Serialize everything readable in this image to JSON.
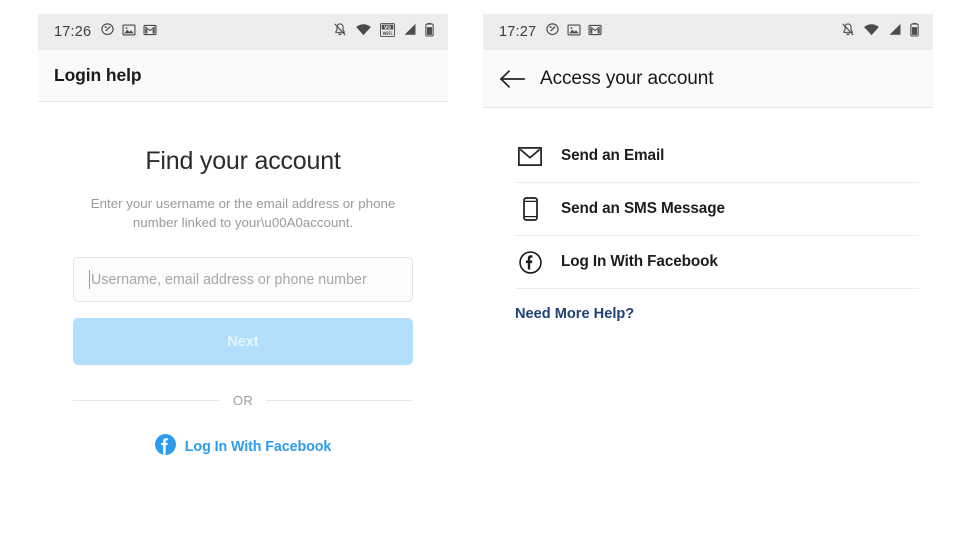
{
  "left_phone": {
    "status_bar": {
      "time": "17:26",
      "left_icons": [
        "tag-icon",
        "photo-icon",
        "gmail-icon"
      ],
      "right_icons": [
        "notifications-muted-icon",
        "wifi-icon",
        "vowifi-badge-icon",
        "cellular-signal-icon",
        "battery-icon"
      ],
      "vowifi_badge_top": "VO",
      "vowifi_badge_bottom": "WiFi"
    },
    "app_bar": {
      "title": "Login help"
    },
    "content": {
      "heading": "Find your account",
      "subtitle": "Enter your username or the email address or phone number linked to your\\u00A0account.",
      "input": {
        "placeholder": "Username, email address or phone number",
        "value": ""
      },
      "next_button": {
        "label": "Next",
        "enabled": false
      },
      "divider_label": "OR",
      "facebook_login": {
        "label": "Log In With Facebook",
        "glyph": "f"
      }
    }
  },
  "right_phone": {
    "status_bar": {
      "time": "17:27",
      "left_icons": [
        "tag-icon",
        "photo-icon",
        "gmail-icon"
      ],
      "right_icons": [
        "notifications-muted-icon",
        "wifi-icon",
        "cellular-signal-icon",
        "battery-icon"
      ]
    },
    "app_bar": {
      "back_label": "back-arrow",
      "title": "Access your account"
    },
    "options": [
      {
        "label": "Send an Email",
        "icon": "envelope-icon"
      },
      {
        "label": "Send an SMS Message",
        "icon": "phone-icon"
      },
      {
        "label": "Log In With Facebook",
        "icon": "facebook-outline-icon",
        "glyph": "f"
      }
    ],
    "help_link": "Need More Help?"
  },
  "colors": {
    "status_bar_bg": "#eceded",
    "app_bar_bg": "#fafafa",
    "facebook_blue": "#2d9cec",
    "disabled_button": "#b2dffc",
    "link_navy": "#1f4175",
    "text_primary": "#1b1d1f",
    "text_muted": "#9a9a9a"
  }
}
